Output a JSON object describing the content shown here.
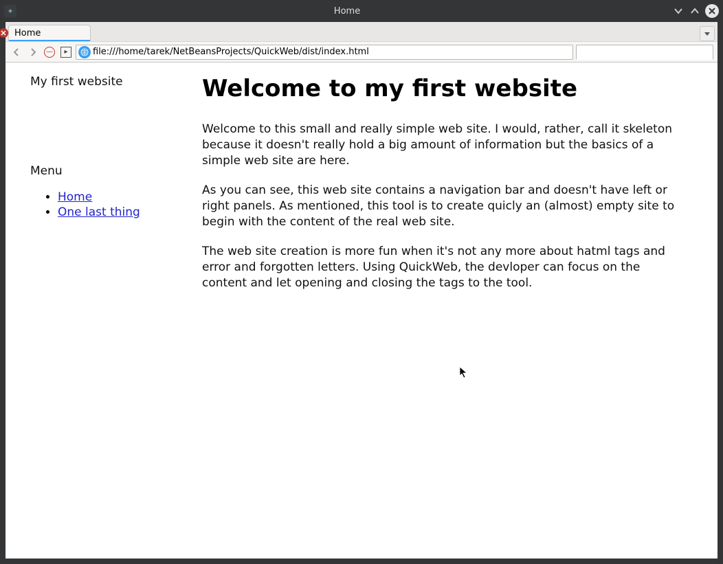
{
  "window": {
    "title": "Home"
  },
  "tabs": {
    "active": {
      "label": "Home"
    }
  },
  "nav": {
    "url": "file:///home/tarek/NetBeansProjects/QuickWeb/dist/index.html"
  },
  "page": {
    "site_title": "My first website",
    "menu_heading": "Menu",
    "menu_items": [
      {
        "label": "Home"
      },
      {
        "label": "One last thing"
      }
    ],
    "heading": "Welcome to my first website",
    "paragraphs": [
      "Welcome to this small and really simple web site. I would, rather, call it skeleton because it doesn't really hold a big amount of information but the basics of a simple web site are here.",
      "As you can see, this web site contains a navigation bar and doesn't have left or right panels. As mentioned, this tool is to create quicly an (almost) empty site to begin with the content of the real web site.",
      "The web site creation is more fun when it's not any more about hatml tags and error and forgotten letters. Using QuickWeb, the devloper can focus on the content and let opening and closing the tags to the tool."
    ]
  }
}
